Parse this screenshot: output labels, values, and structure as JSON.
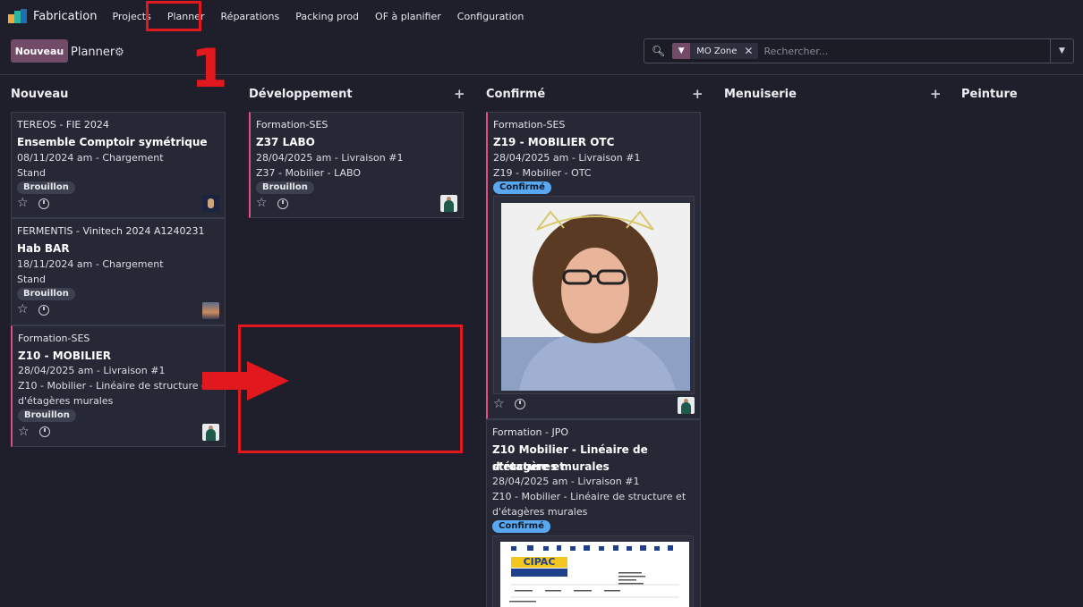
{
  "app": {
    "name": "Fabrication"
  },
  "menu": [
    "Projects",
    "Planner",
    "Réparations",
    "Packing prod",
    "OF à planifier",
    "Configuration"
  ],
  "control_panel": {
    "new_button": "Nouveau",
    "breadcrumb": "Planner"
  },
  "search": {
    "facet": "MO Zone",
    "placeholder": "Rechercher..."
  },
  "columns": [
    "Nouveau",
    "Développement",
    "Confirmé",
    "Menuiserie",
    "Peinture"
  ],
  "cards": {
    "c1": {
      "partner": "TEREOS - FIE 2024",
      "title": "Ensemble Comptoir symétrique",
      "line1": "08/11/2024 am - Chargement",
      "line2": "Stand",
      "tag": "Brouillon"
    },
    "c2": {
      "partner": "FERMENTIS - Vinitech 2024 A1240231",
      "title": "Hab BAR",
      "line1": "18/11/2024 am - Chargement",
      "line2": "Stand",
      "tag": "Brouillon"
    },
    "c3": {
      "partner": "Formation-SES",
      "title": "Z10 - MOBILIER",
      "line1": "28/04/2025 am - Livraison #1",
      "line2a": "Z10 - Mobilier - Linéaire de structure et",
      "line2b": "d'étagères murales",
      "tag": "Brouillon"
    },
    "c4": {
      "partner": "Formation-SES",
      "title": "Z37 LABO",
      "line1": "28/04/2025 am - Livraison #1",
      "line2": "Z37 - Mobilier - LABO",
      "tag": "Brouillon"
    },
    "c5": {
      "partner": "Formation-SES",
      "title": "Z19 - MOBILIER OTC",
      "line1": "28/04/2025 am - Livraison #1",
      "line2": "Z19 - Mobilier - OTC",
      "tag": "Confirmé"
    },
    "c6": {
      "partner": "Formation - JPO",
      "title_a": "Z10 Mobilier - Linéaire de structure et",
      "title_b": "d'étagères murales",
      "line1": "28/04/2025 am - Livraison #1",
      "line2a": "Z10 - Mobilier - Linéaire de structure et",
      "line2b": "d'étagères murales",
      "tag": "Confirmé",
      "doc_logo": "CIPAC"
    }
  },
  "annotation": {
    "step": "1"
  },
  "colors": {
    "primary": "#714b67",
    "annotation": "#e1191e",
    "confirmed_tag": "#5aa8f0",
    "card_border": "#e04f7f",
    "background": "#1e1f2b"
  }
}
